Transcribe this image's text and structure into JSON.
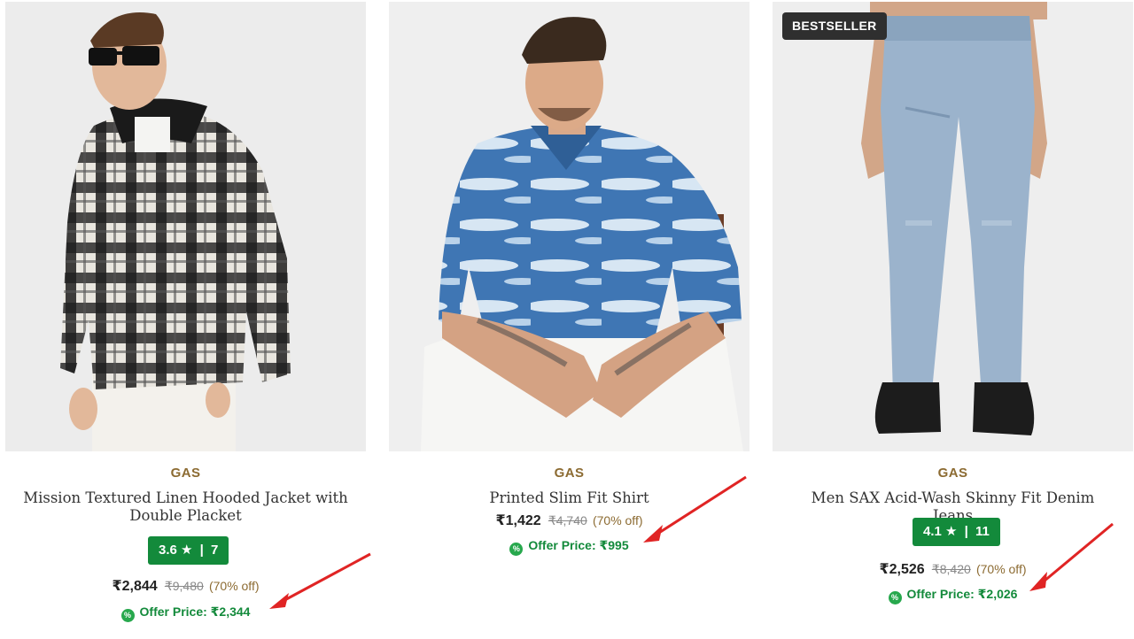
{
  "products": [
    {
      "brand": "GAS",
      "title": "Mission Textured Linen Hooded Jacket with Double Placket",
      "badge": "",
      "rating": "3.6",
      "rating_count": "7",
      "price": "₹2,844",
      "mrp": "₹9,480",
      "discount": "(70% off)",
      "offer_label": "Offer Price: ₹2,344"
    },
    {
      "brand": "GAS",
      "title": "Printed Slim Fit Shirt",
      "badge": "",
      "rating": "",
      "rating_count": "",
      "price": "₹1,422",
      "mrp": "₹4,740",
      "discount": "(70% off)",
      "offer_label": "Offer Price: ₹995"
    },
    {
      "brand": "GAS",
      "title": "Men SAX Acid-Wash Skinny Fit Denim Jeans",
      "badge": "BESTSELLER",
      "rating": "4.1",
      "rating_count": "11",
      "price": "₹2,526",
      "mrp": "₹8,420",
      "discount": "(70% off)",
      "offer_label": "Offer Price: ₹2,026"
    }
  ],
  "ui": {
    "star_glyph": "★",
    "rating_separator": "|",
    "offer_icon_glyph": "%"
  },
  "colors": {
    "brand_text": "#8c6b32",
    "rating_bg": "#138a3b",
    "offer_text": "#138a3b",
    "annotation_arrow": "#e02424",
    "badge_bg": "#2f2f2f"
  }
}
